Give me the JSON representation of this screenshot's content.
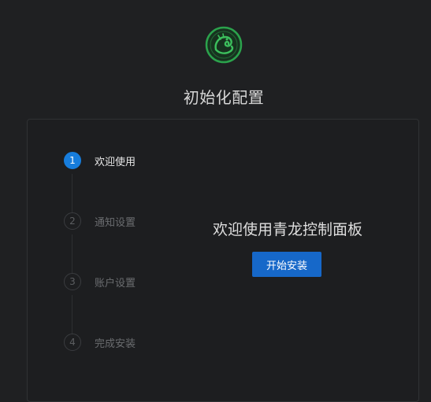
{
  "app": {
    "logo_icon": "qinglong-dragon-logo",
    "title": "初始化配置",
    "accent_color": "#177ddc",
    "logo_color": "#2ba24c"
  },
  "steps": [
    {
      "number": "1",
      "label": "欢迎使用",
      "state": "active"
    },
    {
      "number": "2",
      "label": "通知设置",
      "state": "pending"
    },
    {
      "number": "3",
      "label": "账户设置",
      "state": "pending"
    },
    {
      "number": "4",
      "label": "完成安装",
      "state": "pending"
    }
  ],
  "content": {
    "heading": "欢迎使用青龙控制面板",
    "start_button_label": "开始安装"
  }
}
